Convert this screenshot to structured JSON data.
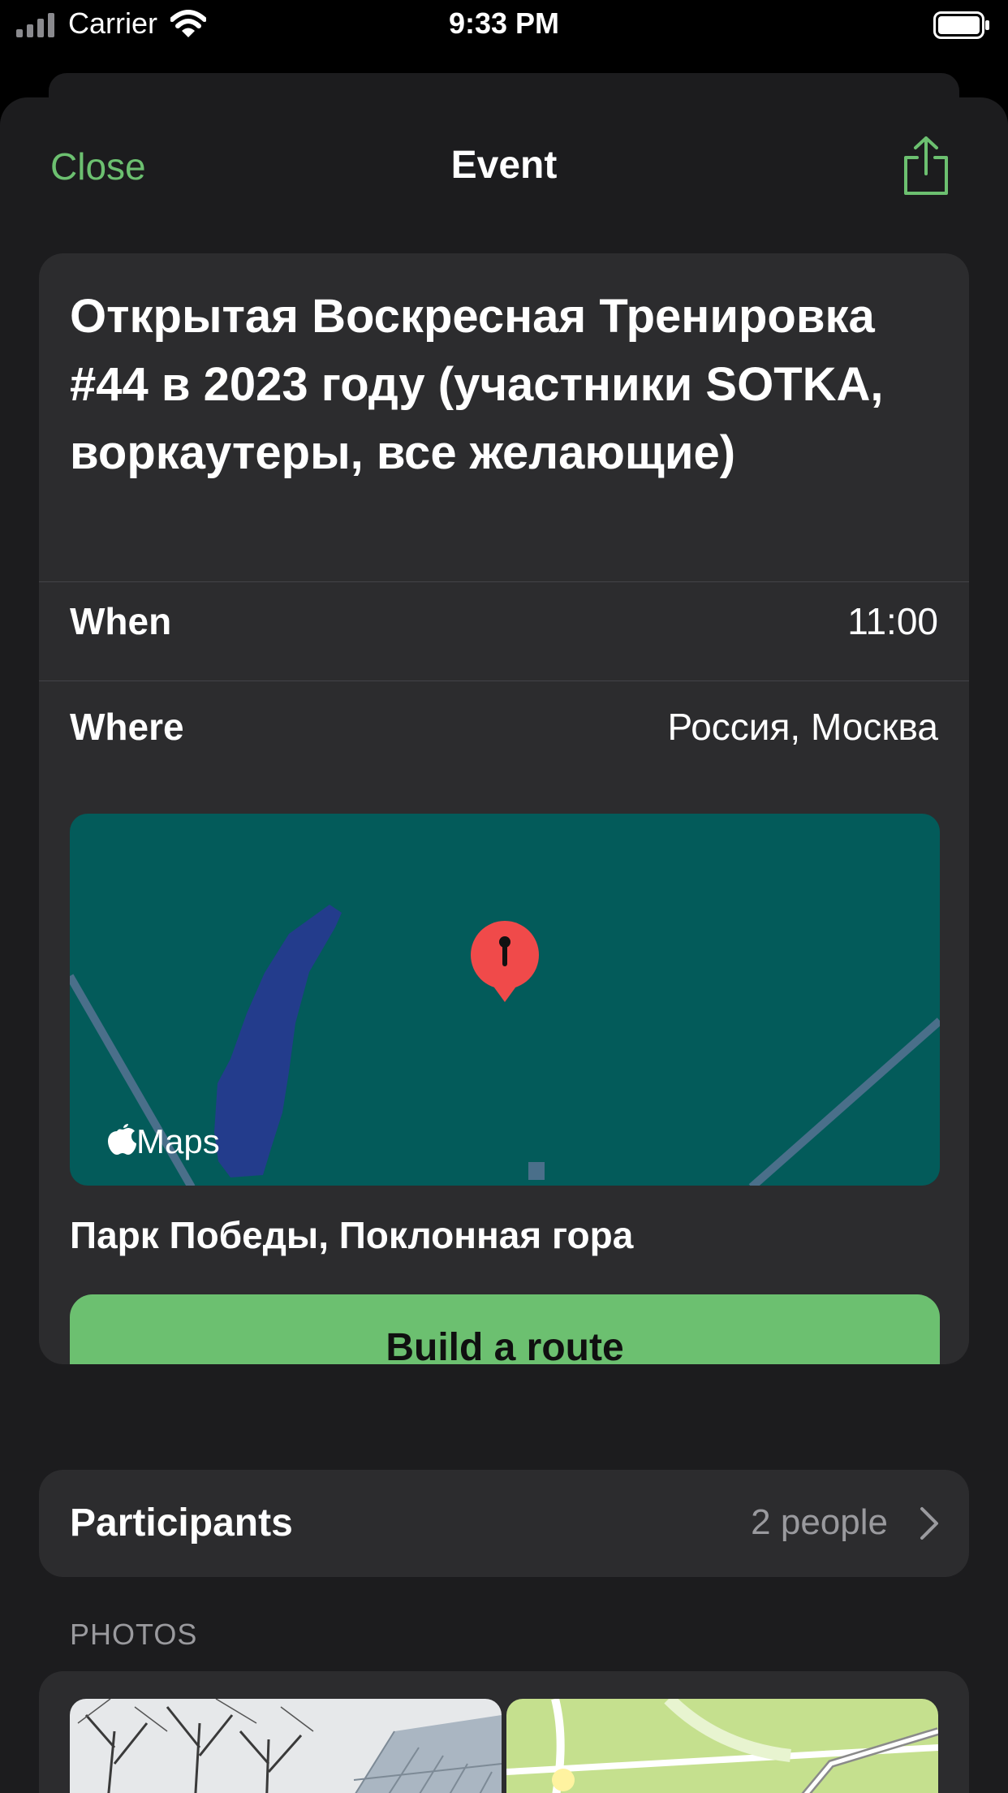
{
  "status_bar": {
    "carrier": "Carrier",
    "time": "9:33 PM"
  },
  "nav": {
    "close_label": "Close",
    "title": "Event"
  },
  "event": {
    "title": "Открытая Воскресная Тренировка #44 в 2023 году (участники SOTKA, воркаутеры, все желающие)",
    "when_label": "When",
    "when_value": "11:00",
    "where_label": "Where",
    "where_value": "Россия, Москва",
    "map_attribution": "Maps",
    "place_name": "Парк Победы, Поклонная гора",
    "route_button": "Build a route"
  },
  "participants": {
    "label": "Participants",
    "count": "2 people"
  },
  "photos": {
    "section_title": "PHOTOS"
  },
  "colors": {
    "accent": "#6cc070",
    "background": "#1c1c1e",
    "card": "#2c2c2e",
    "map_water": "#035b5a",
    "pin": "#f04a4a"
  },
  "icons": [
    "signal-icon",
    "wifi-icon",
    "battery-icon",
    "share-icon",
    "map-pin-icon",
    "apple-logo-icon",
    "chevron-right-icon"
  ]
}
